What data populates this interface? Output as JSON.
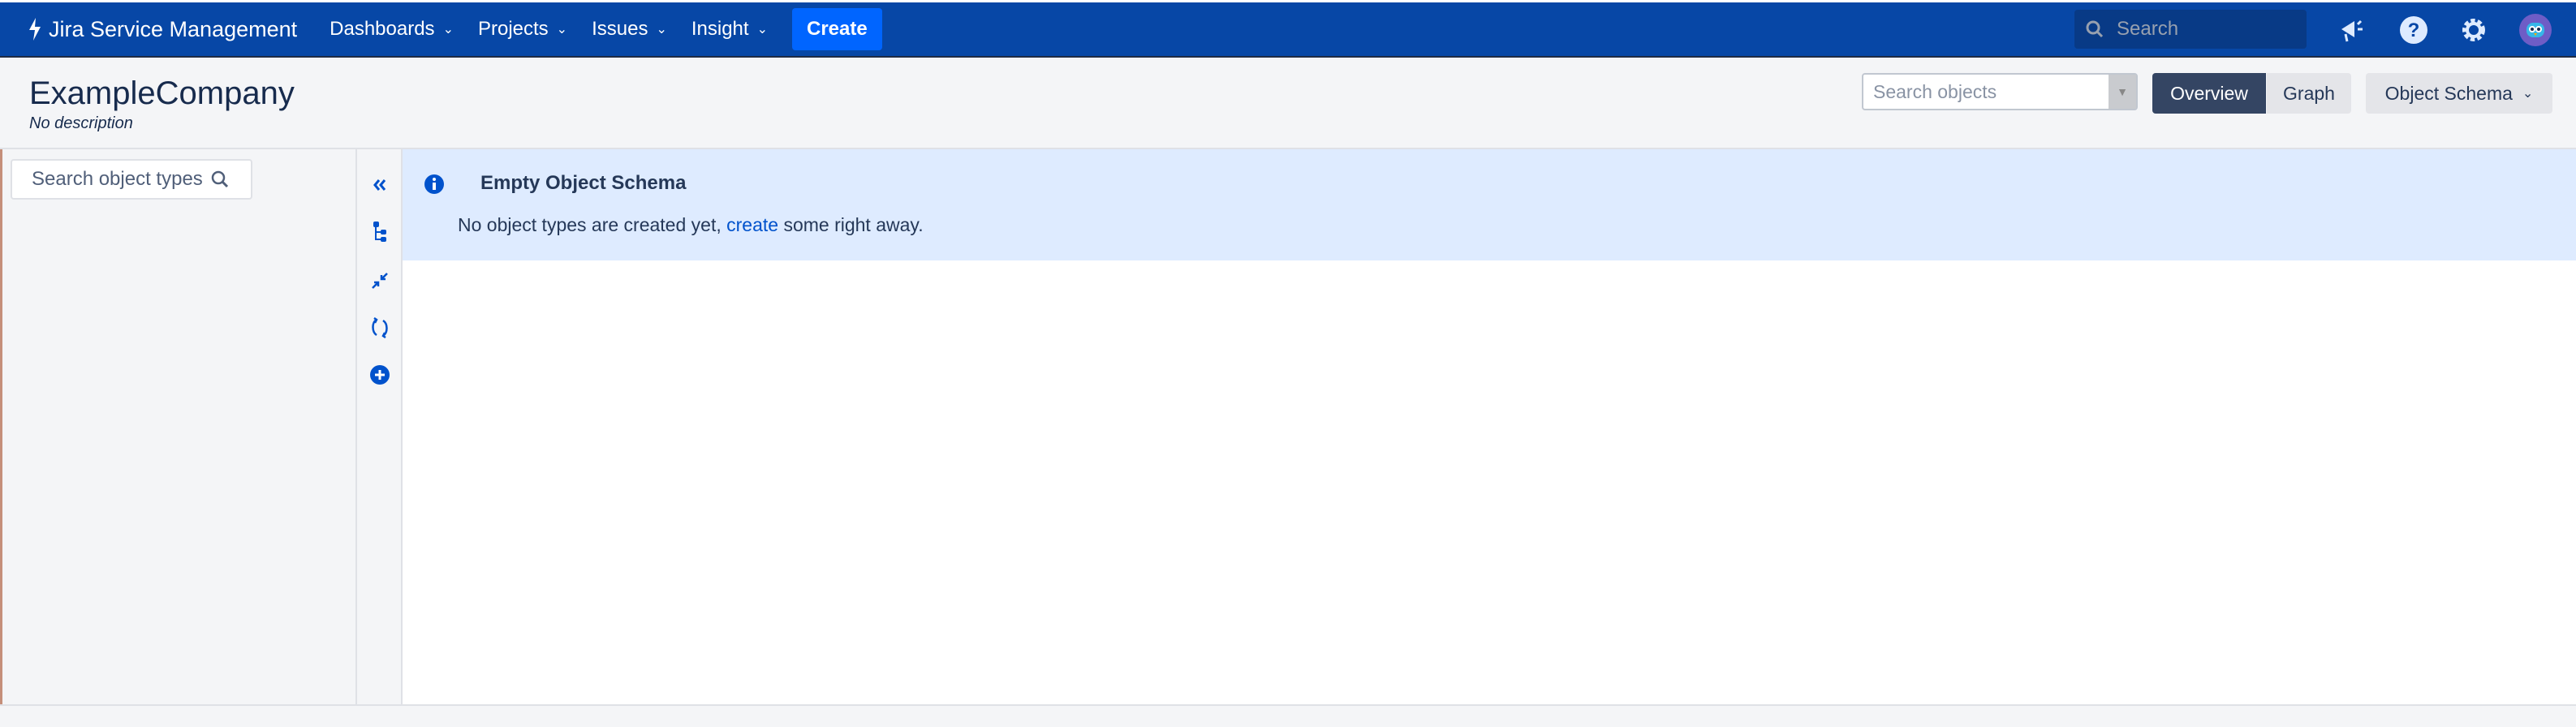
{
  "topbar": {
    "logo": "Jira Service Management",
    "nav": [
      {
        "label": "Dashboards"
      },
      {
        "label": "Projects"
      },
      {
        "label": "Issues"
      },
      {
        "label": "Insight"
      }
    ],
    "create": "Create",
    "search_placeholder": "Search"
  },
  "header": {
    "title": "ExampleCompany",
    "description": "No description",
    "search_objects_placeholder": "Search objects",
    "overview": "Overview",
    "graph": "Graph",
    "object_schema": "Object Schema"
  },
  "sidebar": {
    "search_placeholder": "Search object types"
  },
  "banner": {
    "title": "Empty Object Schema",
    "text_before": "No object types are created yet, ",
    "link": "create",
    "text_after": " some right away."
  },
  "colors": {
    "brand": "#0747a6",
    "accent": "#0065ff",
    "info_bg": "#deebff"
  }
}
